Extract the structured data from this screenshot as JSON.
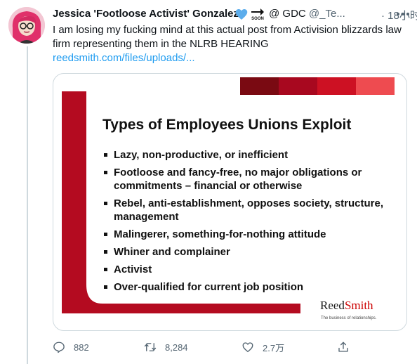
{
  "tweet": {
    "author": {
      "display_name": "Jessica 'Footloose Activist' Gonzalez",
      "at_sign": "@",
      "gdc_label": "GDC",
      "handle": "@_Te...",
      "soon_badge": "SOON"
    },
    "time": "· 18小时",
    "text": "I am losing my fucking mind at this actual post from Activision blizzards law firm representing them in the NLRB HEARING",
    "link": "reedsmith.com/files/uploads/..."
  },
  "media": {
    "title": "Types of Employees Unions Exploit",
    "bullets": [
      "Lazy, non-productive, or inefficient",
      "Footloose and fancy-free, no major obligations or commitments – financial or otherwise",
      "Rebel, anti-establishment, opposes society, structure, management",
      "Malingerer, something-for-nothing attitude",
      "Whiner and complainer",
      "Activist",
      "Over-qualified for current job position"
    ],
    "logo_reed": "Reed",
    "logo_smith": "Smith",
    "tagline": "The business of relationships."
  },
  "actions": {
    "reply_count": "882",
    "retweet_count": "8,284",
    "like_count": "2.7万"
  },
  "colors": {
    "accent_link": "#1d9bf0",
    "slide_red": "#b40b20",
    "muted": "#536471"
  },
  "icons": [
    "more-icon",
    "blue-heart-icon",
    "soon-arrow-icon",
    "reply-icon",
    "retweet-icon",
    "like-icon",
    "share-icon"
  ]
}
